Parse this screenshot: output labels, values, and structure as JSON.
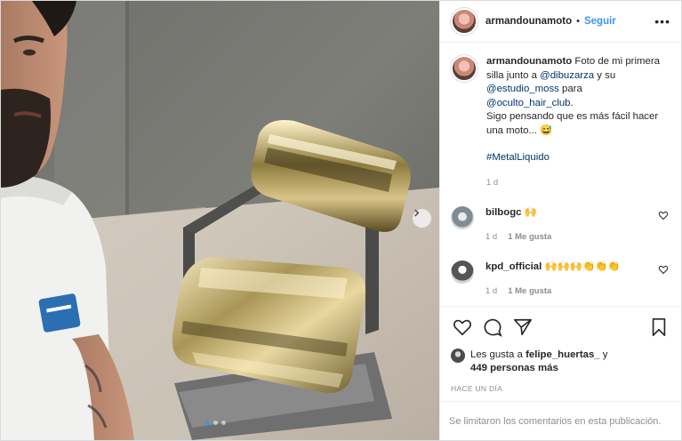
{
  "post": {
    "username": "armandounamoto",
    "separator": "•",
    "follow_label": "Seguir",
    "more_label": "•••"
  },
  "caption": {
    "username": "armandounamoto",
    "text_1": " Foto de mi primera silla junto a ",
    "mention_1": "@dibuzarza",
    "text_2": " y su ",
    "mention_2": "@estudio_moss",
    "text_3": " para ",
    "mention_3": "@oculto_hair_club",
    "text_4": ".",
    "text_5": "Sigo pensando que es más fácil hacer una moto... 😅",
    "hashtag": "#MetalLiquido",
    "time": "1 d"
  },
  "comments": [
    {
      "username": "bilbogc",
      "text": "🙌",
      "time": "1 d",
      "likes": "1 Me gusta"
    },
    {
      "username": "kpd_official",
      "text": "🙌🙌🙌👏👏👏",
      "time": "1 d",
      "likes": "1 Me gusta"
    }
  ],
  "likes": {
    "prefix": "Les gusta a ",
    "user": "felipe_huertas_",
    "middle": " y",
    "others": "449 personas más"
  },
  "time_ago": "Hace un día",
  "limited_notice": "Se limitaron los comentarios en esta publicación.",
  "carousel": {
    "total": 3,
    "active": 0
  },
  "colors": {
    "link": "#003569",
    "accent": "#3897f0",
    "muted": "#8e8e8e"
  }
}
